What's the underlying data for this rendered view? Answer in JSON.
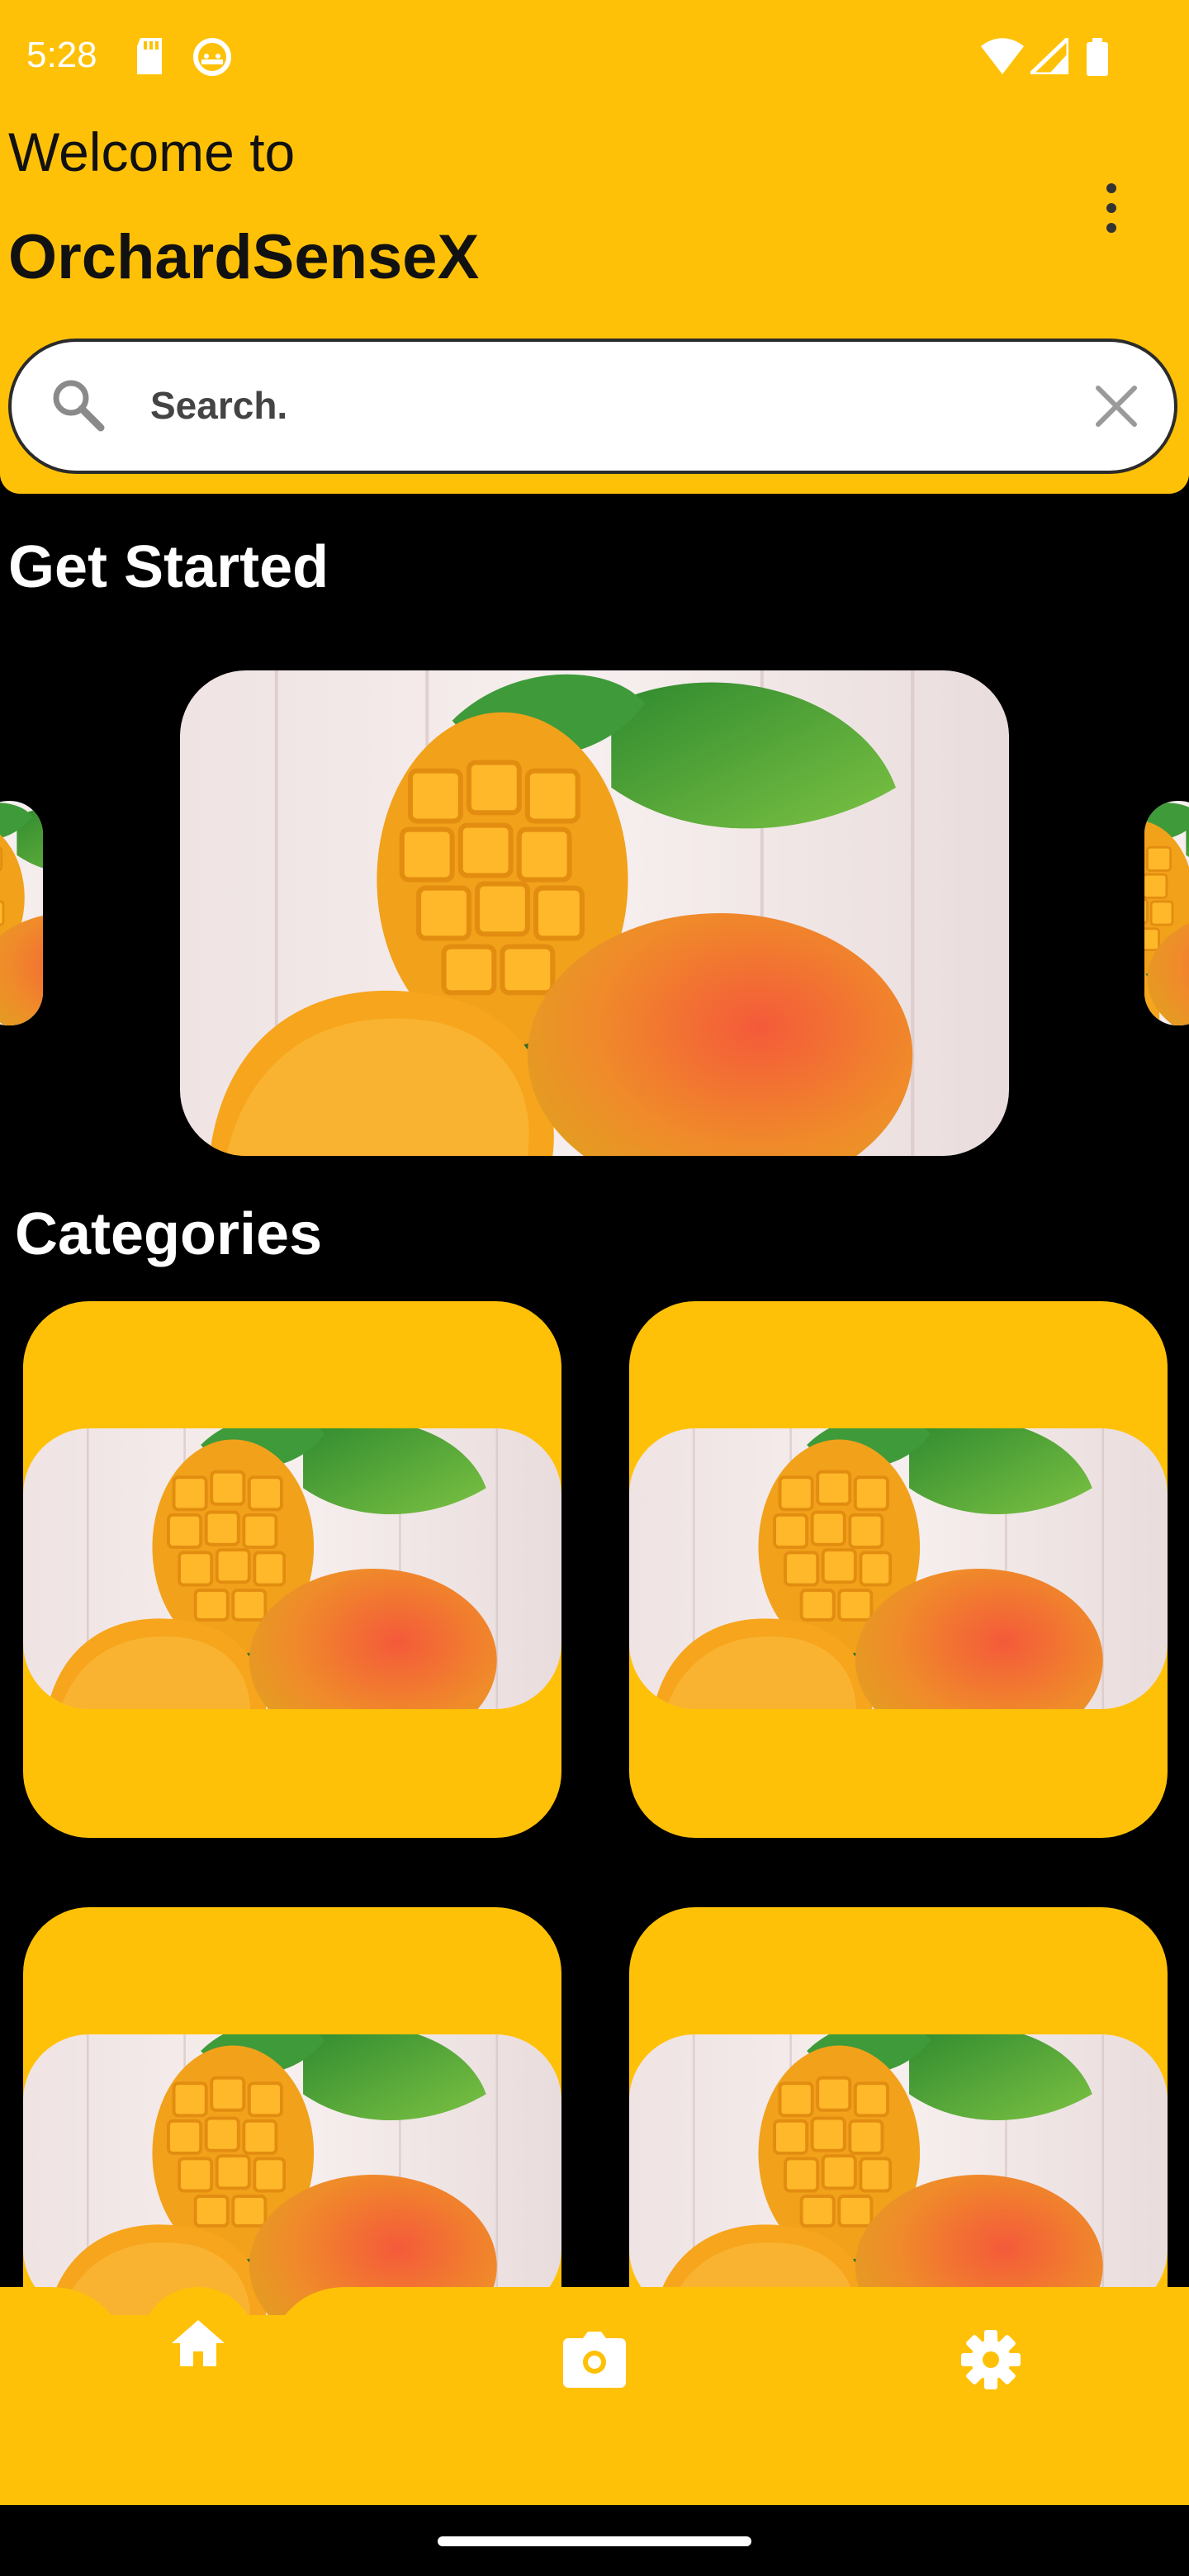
{
  "status_bar": {
    "time": "5:28",
    "icons_left": [
      "sd-card-icon",
      "android-debug-icon"
    ],
    "icons_right": [
      "wifi-icon",
      "signal-icon",
      "battery-icon"
    ]
  },
  "header": {
    "welcome": "Welcome to",
    "app_name": "OrchardSenseX",
    "menu_icon": "more-vert-icon"
  },
  "search": {
    "placeholder": "Search.",
    "clear_icon": "close-icon",
    "search_icon": "search-icon"
  },
  "get_started": {
    "title": "Get Started",
    "slides": [
      "mango-image",
      "mango-image",
      "mango-image"
    ]
  },
  "categories": {
    "title": "Categories",
    "items": [
      "mango-image",
      "mango-image",
      "mango-image",
      "mango-image"
    ]
  },
  "bottom_nav": {
    "items": [
      {
        "icon": "home-icon",
        "active": true
      },
      {
        "icon": "camera-icon",
        "active": false
      },
      {
        "icon": "settings-icon",
        "active": false
      }
    ]
  },
  "colors": {
    "accent": "#FFC107",
    "background": "#000000",
    "text_dark": "#111111"
  }
}
